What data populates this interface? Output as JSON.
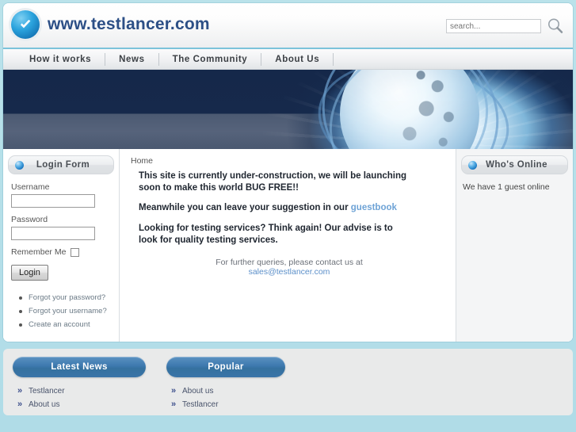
{
  "header": {
    "logo_icon": "check-badge-icon",
    "site_title": "www.testlancer.com",
    "search": {
      "placeholder": "search...",
      "value": "",
      "icon": "search-icon"
    }
  },
  "nav": {
    "items": [
      {
        "label": "How it works"
      },
      {
        "label": "News"
      },
      {
        "label": "The Community"
      },
      {
        "label": "About Us"
      }
    ]
  },
  "banner": {
    "alt": "globe-with-orbits-banner"
  },
  "sidebar_left": {
    "module": {
      "icon": "blue-sphere-icon",
      "title": "Login Form"
    },
    "username_label": "Username",
    "username_value": "",
    "password_label": "Password",
    "password_value": "",
    "remember_label": "Remember Me",
    "login_button": "Login",
    "links": [
      {
        "label": "Forgot your password?"
      },
      {
        "label": "Forgot your username?"
      },
      {
        "label": "Create an account"
      }
    ]
  },
  "main": {
    "breadcrumb": "Home",
    "paragraph_1": "This site is currently under-construction, we will be launching soon to make this world BUG FREE!!",
    "paragraph_2_prefix": "Meanwhile you can leave your suggestion in our ",
    "paragraph_2_link": "guestbook",
    "paragraph_3": "Looking for testing services? Think again! Our advise is to look for quality testing services.",
    "contact_prefix": "For further queries, please contact us at",
    "contact_email": "sales@testlancer.com"
  },
  "sidebar_right": {
    "module": {
      "icon": "blue-sphere-icon",
      "title": "Who's Online"
    },
    "status_text": "We have 1 guest online"
  },
  "footer": {
    "columns": [
      {
        "title": "Latest News",
        "links": [
          {
            "label": "Testlancer"
          },
          {
            "label": "About us"
          }
        ]
      },
      {
        "title": "Popular",
        "links": [
          {
            "label": "About us"
          },
          {
            "label": "Testlancer"
          }
        ]
      }
    ]
  },
  "colors": {
    "page_background": "#b5dee8",
    "brand_text": "#2c4f86",
    "accent_line": "#7bc3da",
    "pill_blue": "#3f7ab0",
    "link_blue": "#5b8fc9",
    "banner_navy": "#15284a",
    "footer_gray": "#e9eaea"
  }
}
